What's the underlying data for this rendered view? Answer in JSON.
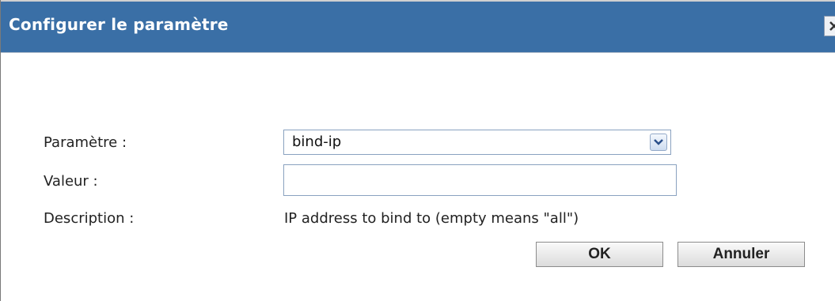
{
  "dialog": {
    "title": "Configurer le paramètre",
    "close_icon": "close-icon"
  },
  "form": {
    "parameter_label": "Paramètre :",
    "parameter_value": "bind-ip",
    "value_label": "Valeur :",
    "value_input": "",
    "value_placeholder": "",
    "description_label": "Description :",
    "description_text": "IP address to bind to (empty means \"all\")"
  },
  "buttons": {
    "ok_label": "OK",
    "cancel_label": "Annuler"
  },
  "colors": {
    "titlebar": "#3a6fa6",
    "title_text": "#ffffff"
  }
}
